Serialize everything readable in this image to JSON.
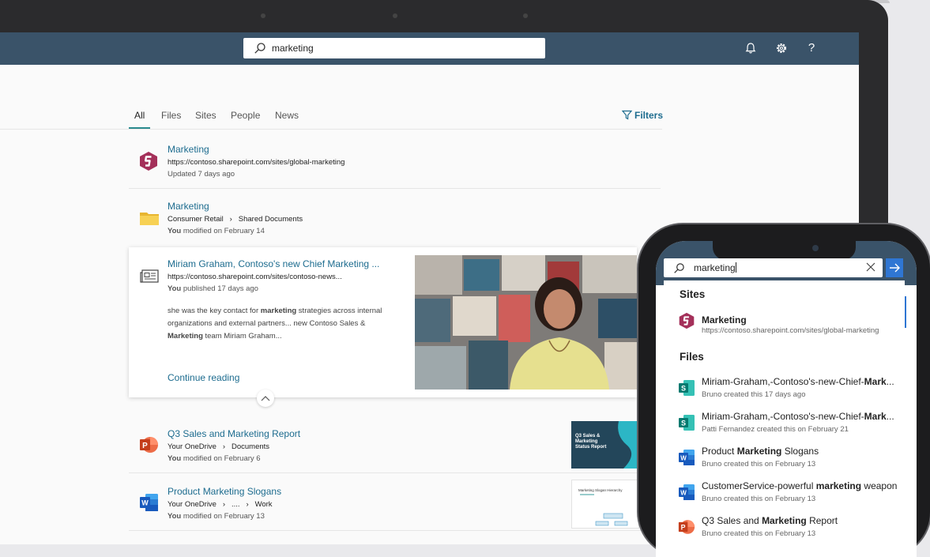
{
  "search": {
    "query": "marketing"
  },
  "tabs": [
    {
      "label": "All",
      "active": true
    },
    {
      "label": "Files"
    },
    {
      "label": "Sites"
    },
    {
      "label": "People"
    },
    {
      "label": "News"
    }
  ],
  "filters_label": "Filters",
  "results": [
    {
      "title": "Marketing",
      "line1": "https://contoso.sharepoint.com/sites/global-marketing",
      "line2": "Updated 7 days ago",
      "icon": "sharepoint-site-icon"
    },
    {
      "title": "Marketing",
      "path": [
        "Consumer Retail",
        "Shared Documents"
      ],
      "line2_prefix": "You",
      "line2_rest": " modified on February 14",
      "icon": "folder-icon"
    },
    {
      "title": "Miriam Graham, Contoso's new Chief Marketing ...",
      "line1": "https://contoso.sharepoint.com/sites/contoso-news...",
      "line2_prefix": "You",
      "line2_rest": " published 17 days ago",
      "snippet": {
        "a": "she was the key contact for ",
        "b": "marketing",
        "c": " strategies across internal organizations and external partners... new Contoso Sales & ",
        "d": "Marketing",
        "e": " team Miriam Graham..."
      },
      "continue_label": "Continue reading",
      "icon": "news-icon"
    },
    {
      "title": "Q3 Sales and Marketing Report",
      "path": [
        "Your OneDrive",
        "Documents"
      ],
      "line2_prefix": "You",
      "line2_rest": " modified on February 6",
      "icon": "powerpoint-icon",
      "thumb_text": [
        "Q3 Sales &",
        "Marketing",
        "Status Report"
      ]
    },
    {
      "title": "Product Marketing Slogans",
      "path": [
        "Your OneDrive",
        "....",
        "Work"
      ],
      "line2_prefix": "You",
      "line2_rest": " modified on February 13",
      "icon": "word-icon",
      "thumb_text": [
        "Marketing Slogan Hierarchy"
      ]
    }
  ],
  "phone": {
    "query": "marketing",
    "sites_heading": "Sites",
    "site": {
      "title": "Marketing",
      "url": "https://contoso.sharepoint.com/sites/global-marketing"
    },
    "files_heading": "Files",
    "files": [
      {
        "t1": "Miriam-Graham,-Contoso's-new-Chief-",
        "b": "Mark",
        "t2": "...",
        "sub": "Bruno created this 17 days ago",
        "icon": "sway-icon"
      },
      {
        "t1": "Miriam-Graham,-Contoso's-new-Chief-",
        "b": "Mark",
        "t2": "...",
        "sub": "Patti Fernandez created this on February 21",
        "icon": "sway-icon"
      },
      {
        "t1": "Product ",
        "b": "Marketing",
        "t2": " Slogans",
        "sub": "Bruno created this on February 13",
        "icon": "word-icon"
      },
      {
        "t1": "CustomerService-powerful ",
        "b": "marketing",
        "t2": " weapon",
        "sub": "Bruno created this on February 13",
        "icon": "word-icon"
      },
      {
        "t1": "Q3 Sales and ",
        "b": "Marketing",
        "t2": " Report",
        "sub": "Bruno created this on February 13",
        "icon": "powerpoint-icon"
      }
    ]
  },
  "colors": {
    "suite_bar": "#3a5369",
    "link": "#1d6c8f",
    "accent": "#2a8a8e",
    "phone_go": "#2f76d3"
  }
}
